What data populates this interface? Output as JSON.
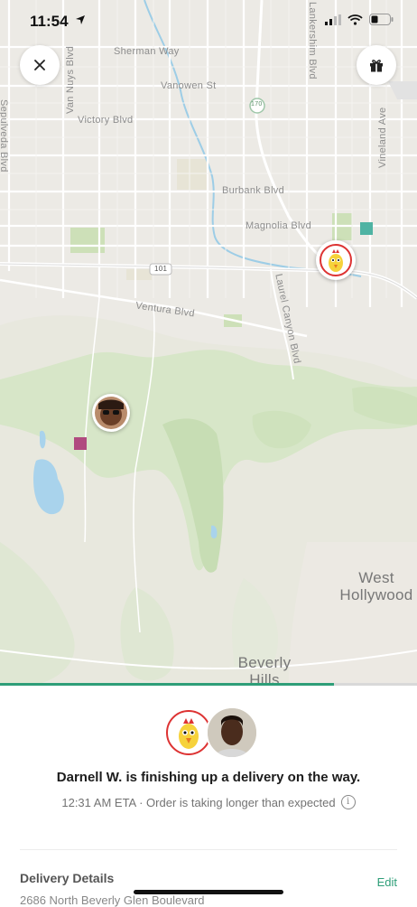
{
  "status_bar": {
    "time": "11:54"
  },
  "map": {
    "streets": {
      "sherman": "Sherman Way",
      "vanowen": "Vanowen St",
      "victory": "Victory Blvd",
      "burbank": "Burbank Blvd",
      "magnolia": "Magnolia Blvd",
      "ventura": "Ventura Blvd",
      "van_nuys": "Van Nuys Blvd",
      "lankershim": "Lankershim Blvd",
      "vineland": "Vineland Ave",
      "laurel": "Laurel Canyon Blvd",
      "sepulveda": "Sepulveda Blvd",
      "hwy_170": "170",
      "hwy_101": "101"
    },
    "places": {
      "west_hollywood_1": "West",
      "west_hollywood_2": "Hollywood",
      "beverly_1": "Beverly",
      "beverly_2": "Hills"
    },
    "restaurant_badge_text": "DAVE'S HOT CHICKEN"
  },
  "buttons": {
    "close_icon": "close-icon",
    "gift_icon": "gift-icon"
  },
  "progress": {
    "fraction": 0.8,
    "color": "#2e9e78"
  },
  "order": {
    "headline": "Darnell W. is finishing up a delivery on the way.",
    "eta": "12:31 AM ETA · Order is taking longer than expected",
    "info_icon": "i"
  },
  "details": {
    "title": "Delivery Details",
    "edit_label": "Edit",
    "address": "2686 North Beverly Glen Boulevard"
  },
  "colors": {
    "accent": "#2e9e78",
    "destination_marker": "#b04a7f",
    "store_marker": "#4fb3a3"
  }
}
